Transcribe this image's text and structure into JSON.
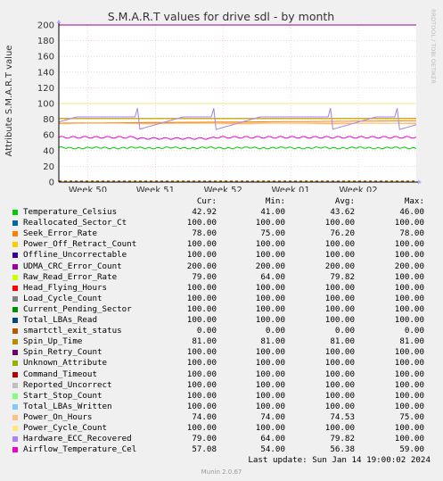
{
  "chart_data": {
    "type": "line",
    "title": "S.M.A.R.T values for drive sdl - by month",
    "ylabel": "Attribute S.M.A.R.T value",
    "watermark": "RRDTOOL / TOBI OETIKER",
    "ylim": [
      0,
      200
    ],
    "yticks": [
      0,
      20,
      40,
      60,
      80,
      100,
      120,
      140,
      160,
      180,
      200
    ],
    "x_range": [
      "2023-12-08",
      "2024-01-14"
    ],
    "xticks": [
      {
        "label": "Week 50",
        "date": "2023-12-11"
      },
      {
        "label": "Week 51",
        "date": "2023-12-18"
      },
      {
        "label": "Week 52",
        "date": "2023-12-25"
      },
      {
        "label": "Week 01",
        "date": "2024-01-01"
      },
      {
        "label": "Week 02",
        "date": "2024-01-08"
      }
    ],
    "threshold_lines": [
      {
        "value": 81,
        "color": "#ccaa00"
      },
      {
        "value": 75,
        "color": "#ffaa44"
      }
    ],
    "columns": [
      "Cur:",
      "Min:",
      "Avg:",
      "Max:"
    ],
    "series": [
      {
        "name": "Temperature_Celsius",
        "color": "#00cc00",
        "cur": "42.92",
        "min": "41.00",
        "avg": "43.62",
        "max": "46.00"
      },
      {
        "name": "Reallocated_Sector_Ct",
        "color": "#0066b3",
        "cur": "100.00",
        "min": "100.00",
        "avg": "100.00",
        "max": "100.00"
      },
      {
        "name": "Seek_Error_Rate",
        "color": "#ff8000",
        "cur": "78.00",
        "min": "75.00",
        "avg": "76.20",
        "max": "78.00"
      },
      {
        "name": "Power_Off_Retract_Count",
        "color": "#ffcc00",
        "cur": "100.00",
        "min": "100.00",
        "avg": "100.00",
        "max": "100.00"
      },
      {
        "name": "Offline_Uncorrectable",
        "color": "#330099",
        "cur": "100.00",
        "min": "100.00",
        "avg": "100.00",
        "max": "100.00"
      },
      {
        "name": "UDMA_CRC_Error_Count",
        "color": "#990099",
        "cur": "200.00",
        "min": "200.00",
        "avg": "200.00",
        "max": "200.00"
      },
      {
        "name": "Raw_Read_Error_Rate",
        "color": "#ccff00",
        "cur": "79.00",
        "min": "64.00",
        "avg": "79.82",
        "max": "100.00"
      },
      {
        "name": "Head_Flying_Hours",
        "color": "#ff0000",
        "cur": "100.00",
        "min": "100.00",
        "avg": "100.00",
        "max": "100.00"
      },
      {
        "name": "Load_Cycle_Count",
        "color": "#808080",
        "cur": "100.00",
        "min": "100.00",
        "avg": "100.00",
        "max": "100.00"
      },
      {
        "name": "Current_Pending_Sector",
        "color": "#008f00",
        "cur": "100.00",
        "min": "100.00",
        "avg": "100.00",
        "max": "100.00"
      },
      {
        "name": "Total_LBAs_Read",
        "color": "#00487d",
        "cur": "100.00",
        "min": "100.00",
        "avg": "100.00",
        "max": "100.00"
      },
      {
        "name": "smartctl_exit_status",
        "color": "#b35a00",
        "cur": "0.00",
        "min": "0.00",
        "avg": "0.00",
        "max": "0.00"
      },
      {
        "name": "Spin_Up_Time",
        "color": "#b38f00",
        "cur": "81.00",
        "min": "81.00",
        "avg": "81.00",
        "max": "81.00"
      },
      {
        "name": "Spin_Retry_Count",
        "color": "#6b006b",
        "cur": "100.00",
        "min": "100.00",
        "avg": "100.00",
        "max": "100.00"
      },
      {
        "name": "Unknown_Attribute",
        "color": "#8fb300",
        "cur": "100.00",
        "min": "100.00",
        "avg": "100.00",
        "max": "100.00"
      },
      {
        "name": "Command_Timeout",
        "color": "#b30000",
        "cur": "100.00",
        "min": "100.00",
        "avg": "100.00",
        "max": "100.00"
      },
      {
        "name": "Reported_Uncorrect",
        "color": "#bebebe",
        "cur": "100.00",
        "min": "100.00",
        "avg": "100.00",
        "max": "100.00"
      },
      {
        "name": "Start_Stop_Count",
        "color": "#80ff80",
        "cur": "100.00",
        "min": "100.00",
        "avg": "100.00",
        "max": "100.00"
      },
      {
        "name": "Total_LBAs_Written",
        "color": "#80c9ff",
        "cur": "100.00",
        "min": "100.00",
        "avg": "100.00",
        "max": "100.00"
      },
      {
        "name": "Power_On_Hours",
        "color": "#ffc080",
        "cur": "74.00",
        "min": "74.00",
        "avg": "74.53",
        "max": "75.00"
      },
      {
        "name": "Power_Cycle_Count",
        "color": "#ffe680",
        "cur": "100.00",
        "min": "100.00",
        "avg": "100.00",
        "max": "100.00"
      },
      {
        "name": "Hardware_ECC_Recovered",
        "color": "#aa80ff",
        "cur": "79.00",
        "min": "64.00",
        "avg": "79.82",
        "max": "100.00"
      },
      {
        "name": "Airflow_Temperature_Cel",
        "color": "#ee00cc",
        "cur": "57.08",
        "min": "54.00",
        "avg": "56.38",
        "max": "59.00"
      }
    ]
  },
  "footer": {
    "last_update": "Last update: Sun Jan 14 19:00:02 2024",
    "version": "Munin 2.0.67"
  }
}
